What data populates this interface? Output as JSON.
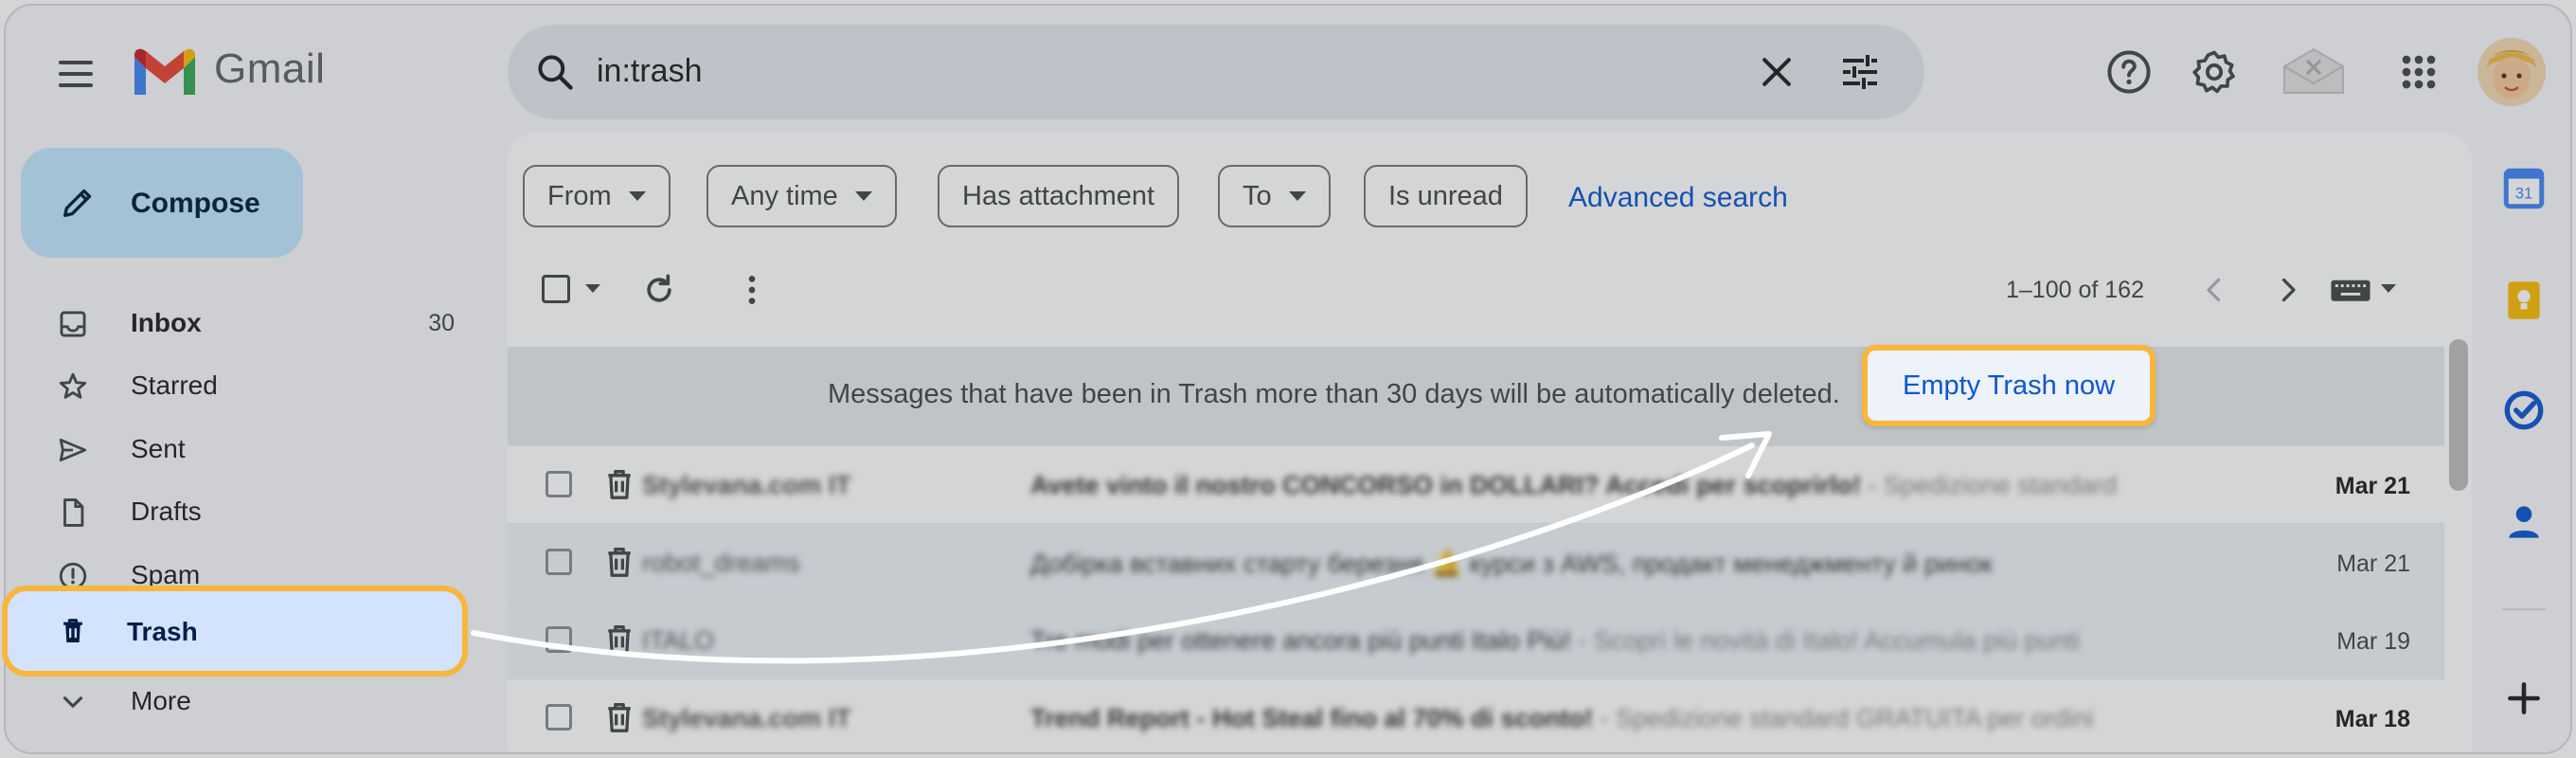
{
  "app": {
    "name": "Gmail"
  },
  "search": {
    "query": "in:trash"
  },
  "compose": {
    "label": "Compose"
  },
  "sidebar": {
    "items": [
      {
        "label": "Inbox",
        "count": "30",
        "icon": "inbox-icon"
      },
      {
        "label": "Starred",
        "count": "",
        "icon": "star-icon"
      },
      {
        "label": "Sent",
        "count": "",
        "icon": "send-icon"
      },
      {
        "label": "Drafts",
        "count": "",
        "icon": "draft-icon"
      },
      {
        "label": "Spam",
        "count": "",
        "icon": "spam-icon"
      },
      {
        "label": "Trash",
        "count": "",
        "icon": "trash-icon"
      },
      {
        "label": "More",
        "count": "",
        "icon": "chevron-down-icon"
      }
    ]
  },
  "filters": {
    "chips": [
      "From",
      "Any time",
      "Has attachment",
      "To",
      "Is unread"
    ],
    "advanced": "Advanced search"
  },
  "toolbar": {
    "pagination": "1–100 of 162"
  },
  "banner": {
    "message": "Messages that have been in Trash more than 30 days will be automatically deleted.",
    "action": "Empty Trash now"
  },
  "emails": [
    {
      "sender": "Stylevana.com IT",
      "subject": "Avete vinto il nostro CONCORSO in DOLLARI? Accedi per scoprirlo!",
      "snippet": " - Spedizione standard",
      "date": "Mar 21",
      "unread": true
    },
    {
      "sender": "robot_dreams",
      "subject": "Добірка вставних старту березня 🔔 курси з AWS, продакт менеджменту й ринок",
      "snippet": "",
      "date": "Mar 21",
      "unread": false
    },
    {
      "sender": "ITALO",
      "subject": "Tre modi per ottenere ancora più punti Italo Più!",
      "snippet": " - Scopri le novità di Italo! Accumula più punti",
      "date": "Mar 19",
      "unread": false
    },
    {
      "sender": "Stylevana.com IT",
      "subject": "Trend Report - Hot Steal fino al 70% di sconto!",
      "snippet": " - Spedizione standard GRATUITA per ordini",
      "date": "Mar 18",
      "unread": true
    }
  ],
  "colors": {
    "highlight": "#f6b73c",
    "link": "#0b57d0",
    "compose": "#c2e7ff",
    "selected": "#d3e3fd"
  }
}
